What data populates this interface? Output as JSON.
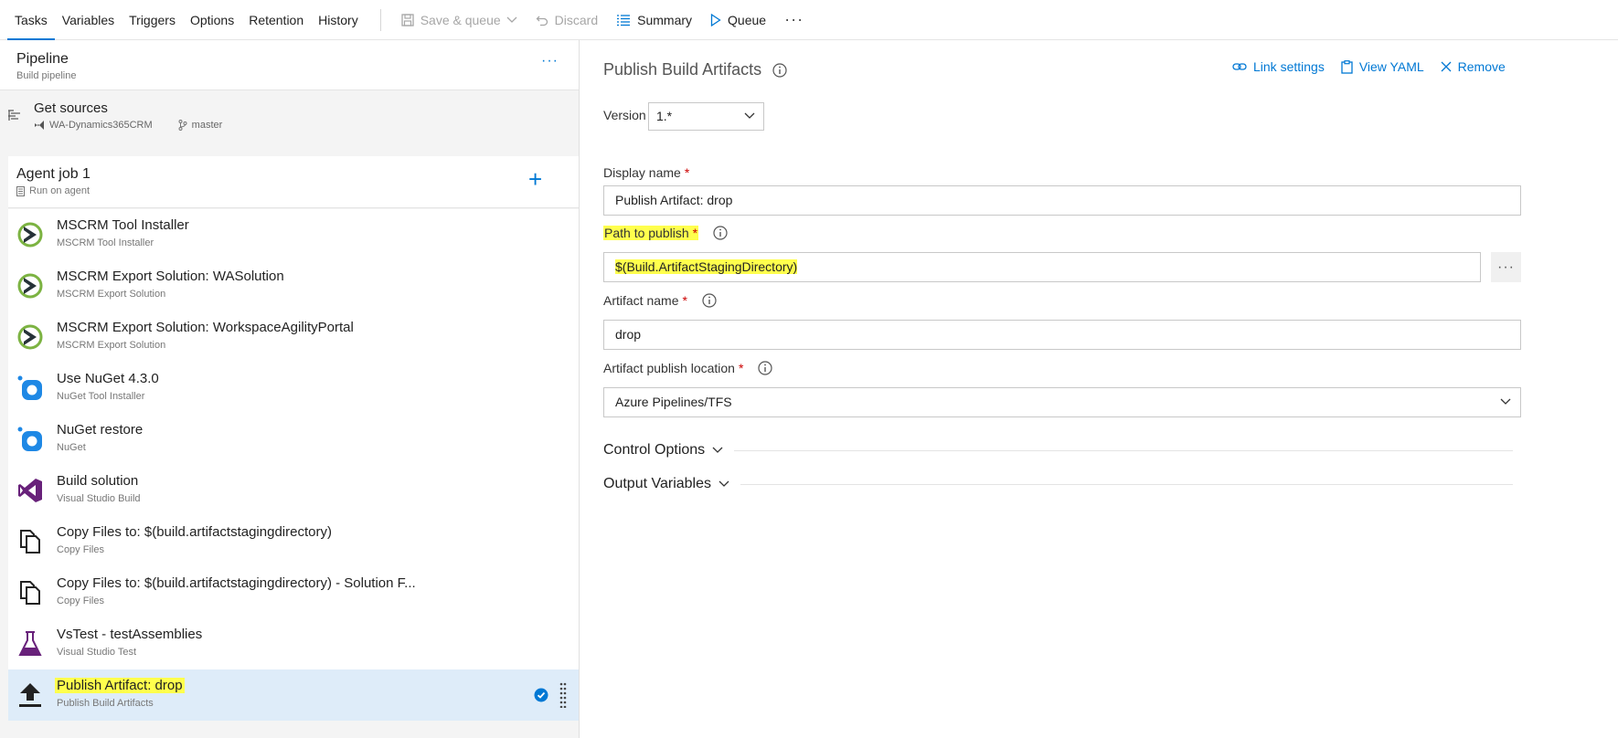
{
  "toolbar": {
    "tabs": [
      "Tasks",
      "Variables",
      "Triggers",
      "Options",
      "Retention",
      "History"
    ],
    "save_queue": "Save & queue",
    "discard": "Discard",
    "summary": "Summary",
    "queue": "Queue",
    "more": "···"
  },
  "pipeline": {
    "title": "Pipeline",
    "subtitle": "Build pipeline",
    "more": "···"
  },
  "sources": {
    "title": "Get sources",
    "repo": "WA-Dynamics365CRM",
    "branch": "master"
  },
  "agent": {
    "title": "Agent job 1",
    "subtitle": "Run on agent",
    "add": "+"
  },
  "tasks": [
    {
      "name": "MSCRM Tool Installer",
      "type": "MSCRM Tool Installer"
    },
    {
      "name": "MSCRM Export Solution: WASolution",
      "type": "MSCRM Export Solution"
    },
    {
      "name": "MSCRM Export Solution: WorkspaceAgilityPortal",
      "type": "MSCRM Export Solution"
    },
    {
      "name": "Use NuGet 4.3.0",
      "type": "NuGet Tool Installer"
    },
    {
      "name": "NuGet restore",
      "type": "NuGet"
    },
    {
      "name": "Build solution",
      "type": "Visual Studio Build"
    },
    {
      "name": "Copy Files to: $(build.artifactstagingdirectory)",
      "type": "Copy Files"
    },
    {
      "name": "Copy Files to: $(build.artifactstagingdirectory) - Solution F...",
      "type": "Copy Files"
    },
    {
      "name": "VsTest - testAssemblies",
      "type": "Visual Studio Test"
    },
    {
      "name": "Publish Artifact: drop",
      "type": "Publish Build Artifacts"
    }
  ],
  "detail": {
    "title": "Publish Build Artifacts",
    "actions": {
      "link": "Link settings",
      "yaml": "View YAML",
      "remove": "Remove"
    },
    "version_label": "Version",
    "version_value": "1.*",
    "display_name_label": "Display name",
    "display_name_value": "Publish Artifact: drop",
    "path_label": "Path to publish",
    "path_value": "$(Build.ArtifactStagingDirectory)",
    "artifact_name_label": "Artifact name",
    "artifact_name_value": "drop",
    "location_label": "Artifact publish location",
    "location_value": "Azure Pipelines/TFS",
    "required_mark": "*",
    "more": "···",
    "control_options": "Control Options",
    "output_variables": "Output Variables"
  },
  "colors": {
    "accent": "#0078d4",
    "highlight": "#ffff4d",
    "selected_row": "#deecf9"
  }
}
